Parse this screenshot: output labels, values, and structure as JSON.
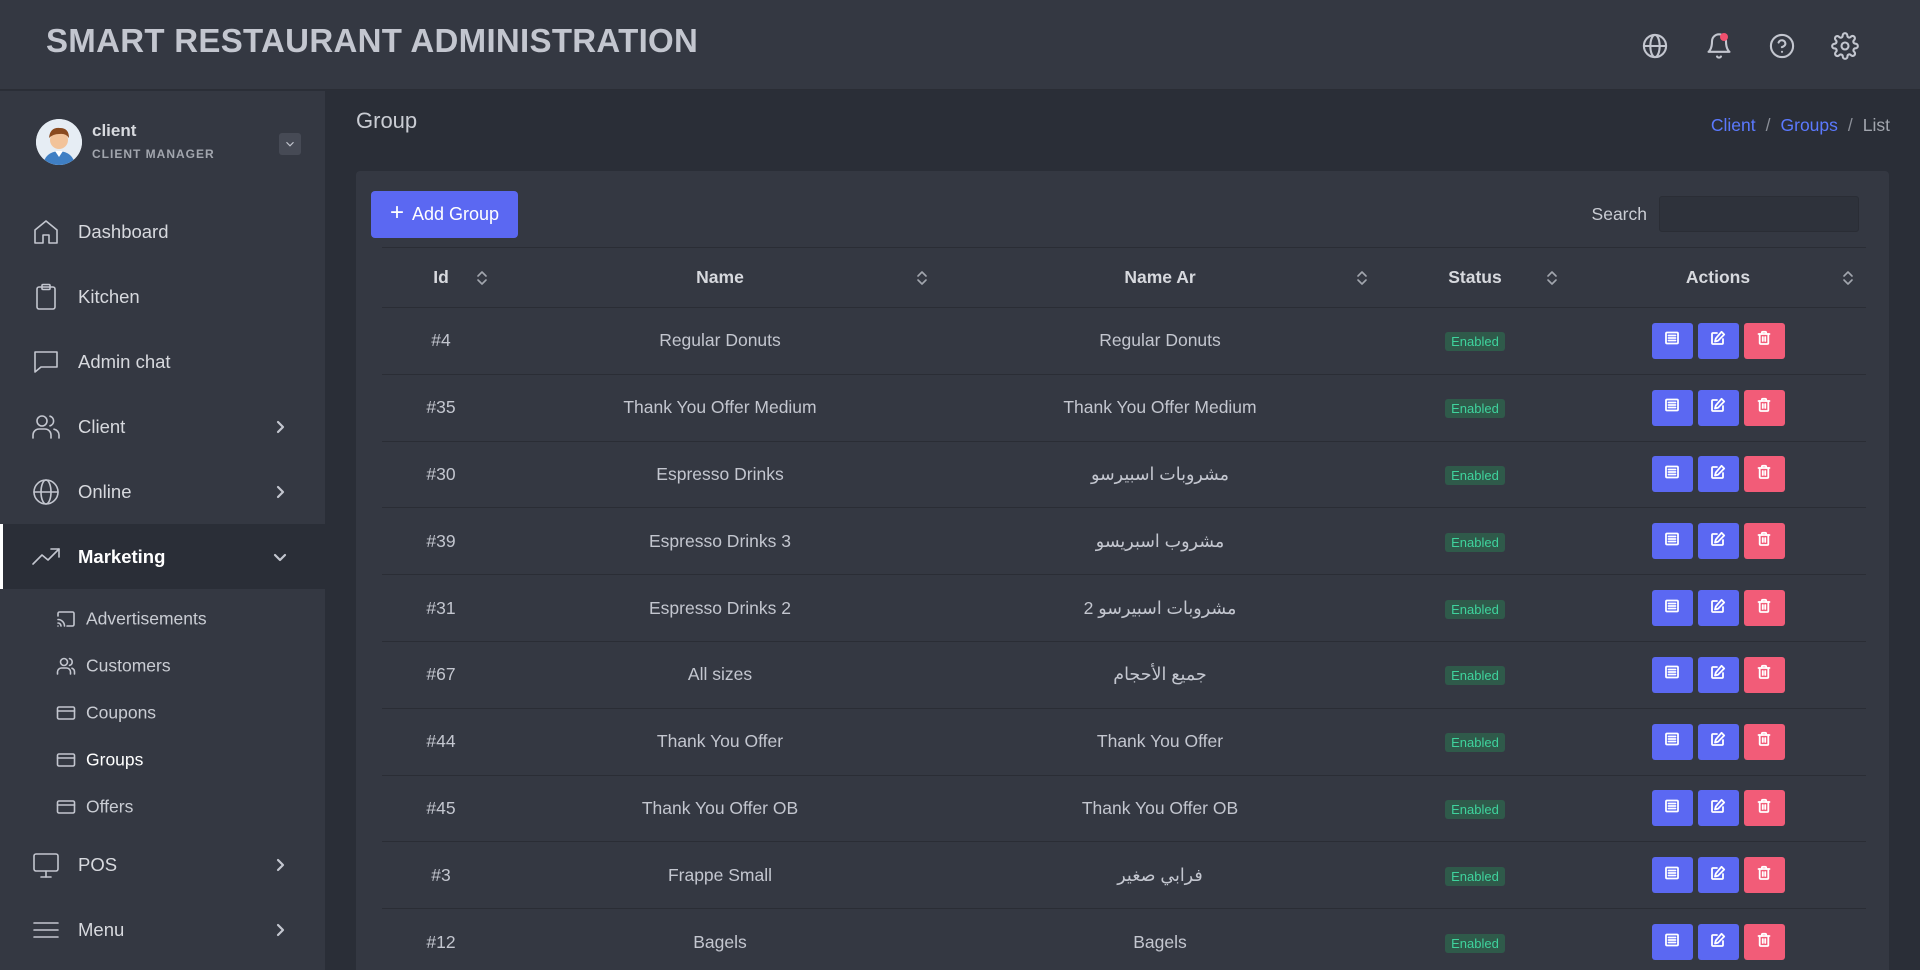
{
  "header": {
    "title": "SMART RESTAURANT ADMINISTRATION",
    "icons": [
      "globe-icon",
      "bell-icon",
      "help-icon",
      "gear-icon"
    ]
  },
  "profile": {
    "name": "client",
    "role": "CLIENT MANAGER"
  },
  "sidebar": {
    "items": [
      {
        "label": "Dashboard",
        "icon": "home-icon"
      },
      {
        "label": "Kitchen",
        "icon": "clipboard-icon"
      },
      {
        "label": "Admin chat",
        "icon": "chat-icon"
      },
      {
        "label": "Client",
        "icon": "users-icon"
      },
      {
        "label": "Online",
        "icon": "globe-icon"
      },
      {
        "label": "Marketing",
        "icon": "trending-up-icon"
      },
      {
        "label": "POS",
        "icon": "monitor-icon"
      },
      {
        "label": "Menu",
        "icon": "menu-icon"
      }
    ],
    "marketing_sub": [
      {
        "label": "Advertisements",
        "icon": "cast-icon"
      },
      {
        "label": "Customers",
        "icon": "user-icon"
      },
      {
        "label": "Coupons",
        "icon": "card-icon"
      },
      {
        "label": "Groups",
        "icon": "card-icon"
      },
      {
        "label": "Offers",
        "icon": "card-icon"
      }
    ]
  },
  "page": {
    "title": "Group",
    "breadcrumb": {
      "client": "Client",
      "groups": "Groups",
      "current": "List",
      "sep": "/"
    }
  },
  "toolbar": {
    "add_label": "Add Group",
    "search_label": "Search",
    "search_value": ""
  },
  "table": {
    "columns": [
      "Id",
      "Name",
      "Name Ar",
      "Status",
      "Actions"
    ],
    "rows": [
      {
        "id": "#4",
        "name": "Regular Donuts",
        "name_ar": "Regular Donuts",
        "status": "Enabled"
      },
      {
        "id": "#35",
        "name": "Thank You Offer Medium",
        "name_ar": "Thank You Offer Medium",
        "status": "Enabled"
      },
      {
        "id": "#30",
        "name": "Espresso Drinks",
        "name_ar": "مشروبات اسبيرسو",
        "status": "Enabled"
      },
      {
        "id": "#39",
        "name": "Espresso Drinks 3",
        "name_ar": "مشروب اسبريسو",
        "status": "Enabled"
      },
      {
        "id": "#31",
        "name": "Espresso Drinks 2",
        "name_ar": "مشروبات اسبيرسو 2",
        "status": "Enabled"
      },
      {
        "id": "#67",
        "name": "All sizes",
        "name_ar": "جميع الأحجام",
        "status": "Enabled"
      },
      {
        "id": "#44",
        "name": "Thank You Offer",
        "name_ar": "Thank You Offer",
        "status": "Enabled"
      },
      {
        "id": "#45",
        "name": "Thank You Offer OB",
        "name_ar": "Thank You Offer OB",
        "status": "Enabled"
      },
      {
        "id": "#3",
        "name": "Frappe Small",
        "name_ar": "فرابي صغير",
        "status": "Enabled"
      },
      {
        "id": "#12",
        "name": "Bagels",
        "name_ar": "Bagels",
        "status": "Enabled"
      }
    ]
  },
  "colors": {
    "accent": "#5b68f2",
    "danger": "#f25c78",
    "success": "#3fd39d",
    "link": "#5b79ff"
  }
}
